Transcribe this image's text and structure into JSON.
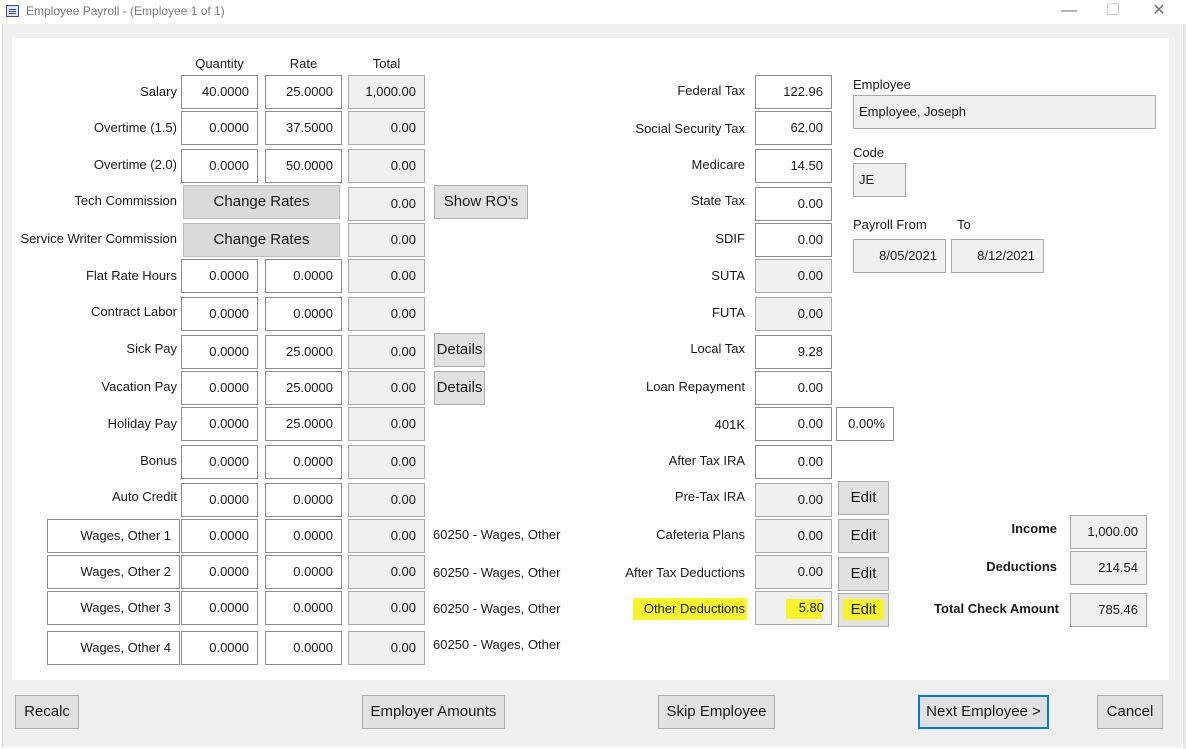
{
  "window": {
    "title": "Employee Payroll - (Employee 1 of 1)",
    "minimize_glyph": "—",
    "maximize_glyph": "☐",
    "close_glyph": "✕"
  },
  "columns": {
    "quantity": "Quantity",
    "rate": "Rate",
    "total": "Total"
  },
  "earnings": {
    "salary": {
      "label": "Salary",
      "qty": "40.0000",
      "rate": "25.0000",
      "total": "1,000.00"
    },
    "ot15": {
      "label": "Overtime (1.5)",
      "qty": "0.0000",
      "rate": "37.5000",
      "total": "0.00"
    },
    "ot20": {
      "label": "Overtime (2.0)",
      "qty": "0.0000",
      "rate": "50.0000",
      "total": "0.00"
    },
    "tech": {
      "label": "Tech Commission",
      "button": "Change Rates",
      "total": "0.00",
      "extra_button": "Show RO's"
    },
    "sw": {
      "label": "Service Writer Commission",
      "button": "Change Rates",
      "total": "0.00"
    },
    "flat": {
      "label": "Flat Rate Hours",
      "qty": "0.0000",
      "rate": "0.0000",
      "total": "0.00"
    },
    "contract": {
      "label": "Contract Labor",
      "qty": "0.0000",
      "rate": "0.0000",
      "total": "0.00"
    },
    "sick": {
      "label": "Sick Pay",
      "qty": "0.0000",
      "rate": "25.0000",
      "total": "0.00",
      "button": "Details"
    },
    "vacation": {
      "label": "Vacation Pay",
      "qty": "0.0000",
      "rate": "25.0000",
      "total": "0.00",
      "button": "Details"
    },
    "holiday": {
      "label": "Holiday Pay",
      "qty": "0.0000",
      "rate": "25.0000",
      "total": "0.00"
    },
    "bonus": {
      "label": "Bonus",
      "qty": "0.0000",
      "rate": "0.0000",
      "total": "0.00"
    },
    "auto": {
      "label": "Auto Credit",
      "qty": "0.0000",
      "rate": "0.0000",
      "total": "0.00"
    },
    "other1": {
      "label": "Wages, Other 1",
      "qty": "0.0000",
      "rate": "0.0000",
      "total": "0.00",
      "account": "60250 - Wages, Other"
    },
    "other2": {
      "label": "Wages, Other 2",
      "qty": "0.0000",
      "rate": "0.0000",
      "total": "0.00",
      "account": "60250 - Wages, Other"
    },
    "other3": {
      "label": "Wages, Other 3",
      "qty": "0.0000",
      "rate": "0.0000",
      "total": "0.00",
      "account": "60250 - Wages, Other"
    },
    "other4": {
      "label": "Wages, Other 4",
      "qty": "0.0000",
      "rate": "0.0000",
      "total": "0.00",
      "account": "60250 - Wages, Other"
    }
  },
  "taxes": {
    "federal": {
      "label": "Federal Tax",
      "value": "122.96"
    },
    "ss": {
      "label": "Social Security Tax",
      "value": "62.00"
    },
    "medicare": {
      "label": "Medicare",
      "value": "14.50"
    },
    "state": {
      "label": "State Tax",
      "value": "0.00"
    },
    "sdif": {
      "label": "SDIF",
      "value": "0.00"
    },
    "suta": {
      "label": "SUTA",
      "value": "0.00"
    },
    "futa": {
      "label": "FUTA",
      "value": "0.00"
    },
    "local": {
      "label": "Local Tax",
      "value": "9.28"
    },
    "loan": {
      "label": "Loan Repayment",
      "value": "0.00"
    },
    "k401": {
      "label": "401K",
      "value": "0.00",
      "percent": "0.00%"
    },
    "ira": {
      "label": "After Tax IRA",
      "value": "0.00"
    },
    "pretaxira": {
      "label": "Pre-Tax IRA",
      "value": "0.00",
      "button": "Edit"
    },
    "cafeteria": {
      "label": "Cafeteria Plans",
      "value": "0.00",
      "button": "Edit"
    },
    "aftertax": {
      "label": "After Tax Deductions",
      "value": "0.00",
      "button": "Edit"
    },
    "other": {
      "label": "Other Deductions",
      "value": "5.80",
      "button": "Edit",
      "highlight_color": "#f7f52a"
    }
  },
  "employee": {
    "label": "Employee",
    "name": "Employee, Joseph",
    "code_label": "Code",
    "code": "JE",
    "payroll_from_label": "Payroll From",
    "to_label": "To",
    "from_date": "8/05/2021",
    "to_date": "8/12/2021"
  },
  "summary": {
    "income_label": "Income",
    "income": "1,000.00",
    "deductions_label": "Deductions",
    "deductions": "214.54",
    "check_label": "Total Check Amount",
    "check": "785.46"
  },
  "footer": {
    "recalc": "Recalc",
    "employer_amounts": "Employer Amounts",
    "skip": "Skip Employee",
    "next": "Next Employee >",
    "cancel": "Cancel"
  },
  "colors": {
    "focus_border": "#0078d7",
    "readonly_bg": "#f0f0f0",
    "highlight": "#f7f52a"
  }
}
